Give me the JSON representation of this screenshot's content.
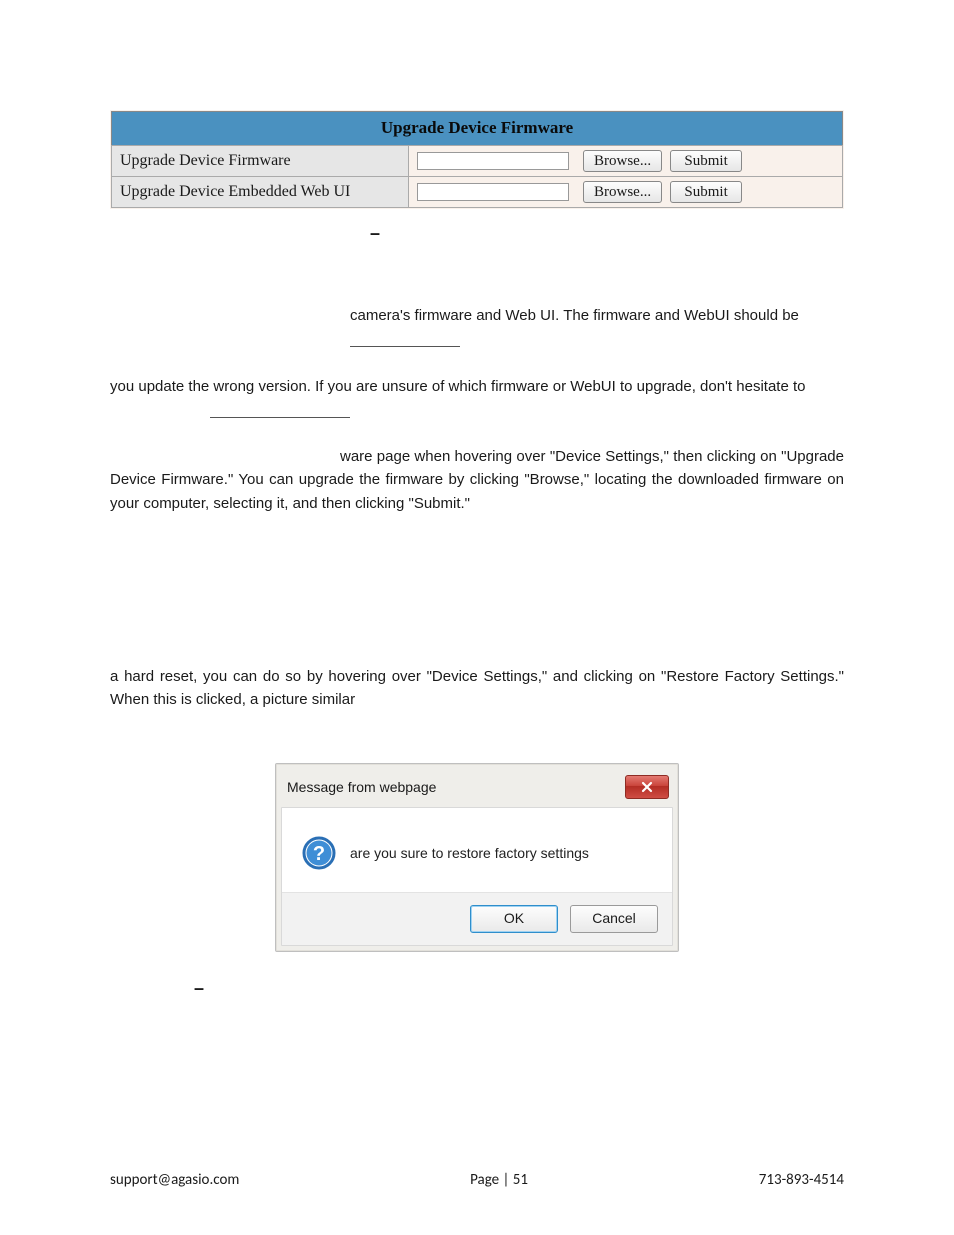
{
  "firmware_panel": {
    "title": "Upgrade Device Firmware",
    "rows": [
      {
        "label": "Upgrade Device Firmware",
        "browse": "Browse...",
        "submit": "Submit"
      },
      {
        "label": "Upgrade Device Embedded Web UI",
        "browse": "Browse...",
        "submit": "Submit"
      }
    ]
  },
  "paragraphs": {
    "p1": "camera's firmware and Web UI. The firmware and WebUI should be",
    "p2": "you update the wrong version. If you are unsure of which firmware or WebUI to upgrade, don't hesitate to",
    "p3": "ware page when hovering over \"Device Settings,\" then clicking on \"Upgrade Device Firmware.\" You can upgrade the firmware by clicking \"Browse,\" locating the downloaded firmware on your computer, selecting it, and then clicking \"Submit.\"",
    "p4": "a hard reset, you can do so by hovering over \"Device Settings,\" and clicking on \"Restore Factory Settings.\" When this is clicked, a picture similar"
  },
  "dialog": {
    "title": "Message from webpage",
    "message": "are you sure to restore factory settings",
    "ok": "OK",
    "cancel": "Cancel"
  },
  "footer": {
    "email": "support@agasio.com",
    "page": "Page | 51",
    "phone": "713-893-4514"
  }
}
